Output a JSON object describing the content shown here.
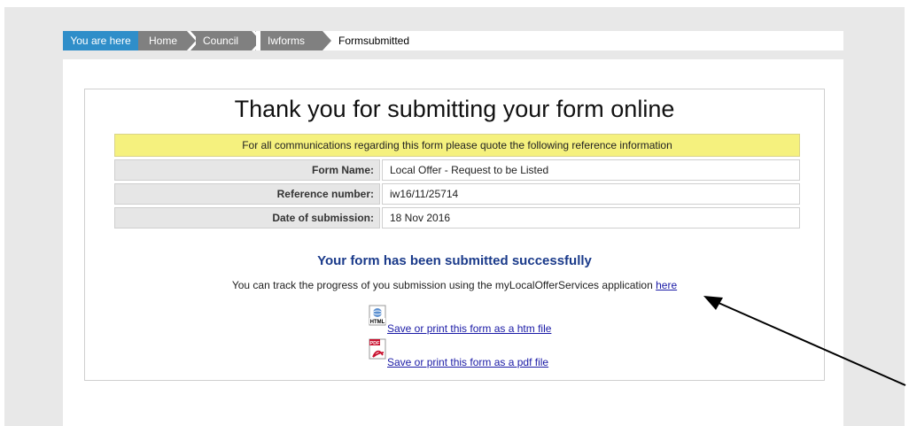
{
  "breadcrumb": {
    "you_are_here": "You are here",
    "items": [
      "Home",
      "Council",
      "Iwforms"
    ],
    "current": "Formsubmitted"
  },
  "page": {
    "title": "Thank you for submitting your form online",
    "notice": "For all communications regarding this form please quote the following reference information",
    "fields": [
      {
        "label": "Form Name:",
        "value": "Local Offer - Request to be Listed"
      },
      {
        "label": "Reference number:",
        "value": "iw16/11/25714"
      },
      {
        "label": "Date of submission:",
        "value": "18 Nov 2016"
      }
    ],
    "success_message": "Your form has been submitted successfully",
    "track_text": "You can track the progress of you submission using the myLocalOfferServices application",
    "track_link": "here",
    "downloads": [
      {
        "icon": "html-file-icon",
        "badge": "HTML",
        "label": "Save or print this form as a htm file"
      },
      {
        "icon": "pdf-file-icon",
        "badge": "PDF",
        "label": "Save or print this form as a pdf file"
      }
    ]
  },
  "colors": {
    "breadcrumb_accent": "#2f8ec9",
    "breadcrumb_item": "#808080",
    "notice_bg": "#f5f17e",
    "success_text": "#1a3a8a",
    "link": "#1a1aa6"
  }
}
